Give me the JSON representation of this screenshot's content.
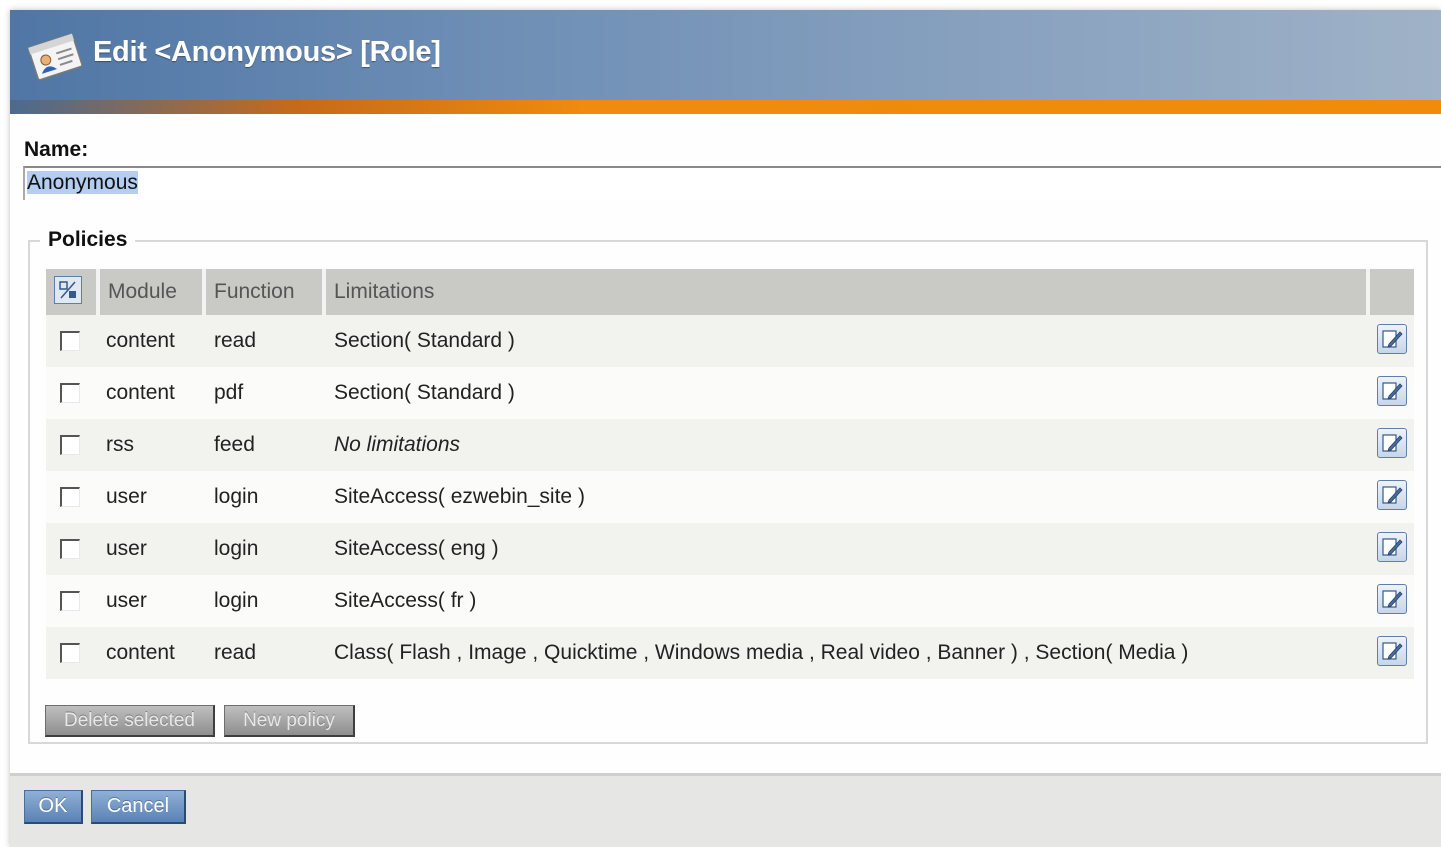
{
  "window": {
    "title": "Edit <Anonymous> [Role]",
    "icon": "role-edit-icon"
  },
  "name_field": {
    "label": "Name:",
    "value": "Anonymous"
  },
  "policies": {
    "legend": "Policies",
    "columns": [
      "Module",
      "Function",
      "Limitations"
    ],
    "toggle_icon": "toggle-selection-icon",
    "rows": [
      {
        "module": "content",
        "function": "read",
        "limitations": "Section( Standard )",
        "italic": false
      },
      {
        "module": "content",
        "function": "pdf",
        "limitations": "Section( Standard )",
        "italic": false
      },
      {
        "module": "rss",
        "function": "feed",
        "limitations": "No limitations",
        "italic": true
      },
      {
        "module": "user",
        "function": "login",
        "limitations": "SiteAccess( ezwebin_site )",
        "italic": false
      },
      {
        "module": "user",
        "function": "login",
        "limitations": "SiteAccess( eng )",
        "italic": false
      },
      {
        "module": "user",
        "function": "login",
        "limitations": "SiteAccess( fr )",
        "italic": false
      },
      {
        "module": "content",
        "function": "read",
        "limitations": "Class( Flash , Image , Quicktime , Windows media , Real video , Banner ) , Section( Media )",
        "italic": false
      }
    ],
    "row_edit_icon": "edit-icon",
    "delete_button": "Delete selected",
    "new_button": "New policy"
  },
  "footer": {
    "ok_label": "OK",
    "cancel_label": "Cancel"
  },
  "colors": {
    "titlebar": "#4f76a5",
    "accent_stripe": "#ef8b0e",
    "header_cells": "#c9c9c5",
    "primary_button": "#5a82b5"
  }
}
